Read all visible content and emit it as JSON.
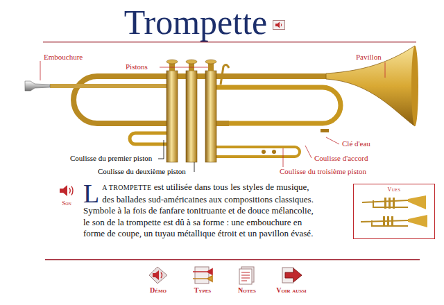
{
  "title": "Trompette",
  "parts": [
    {
      "label": "Embouchure",
      "color": "#c0282d"
    },
    {
      "label": "Pistons",
      "color": "#c0282d"
    },
    {
      "label": "Pavillon",
      "color": "#c0282d"
    },
    {
      "label": "Clé d'eau",
      "color": "#c0282d"
    },
    {
      "label": "Coulisse d'accord",
      "color": "#c0282d"
    },
    {
      "label": "Coulisse du troisième piston",
      "color": "#c0282d"
    },
    {
      "label": "Coulisse du premier piston",
      "color": "#000000"
    },
    {
      "label": "Coulisse du deuxième piston",
      "color": "#000000"
    }
  ],
  "sound": {
    "label": "Son"
  },
  "intro": {
    "drop_cap": "L",
    "lead": "A TROMPETTE",
    "lines": [
      " est utilisée dans tous les styles de musique,",
      "des ballades sud-américaines aux compositions classiques.",
      "Symbole à la fois de fanfare tonitruante et de douce mélancolie,",
      "le son de la trompette est dû à sa forme : une embouchure en",
      "forme de coupe, un tuyau métallique étroit et un pavillon évasé."
    ]
  },
  "views": {
    "label": "Vues"
  },
  "nav": [
    {
      "label": "Démo"
    },
    {
      "label": "Types"
    },
    {
      "label": "Notes"
    },
    {
      "label": "Voir aussi"
    }
  ]
}
